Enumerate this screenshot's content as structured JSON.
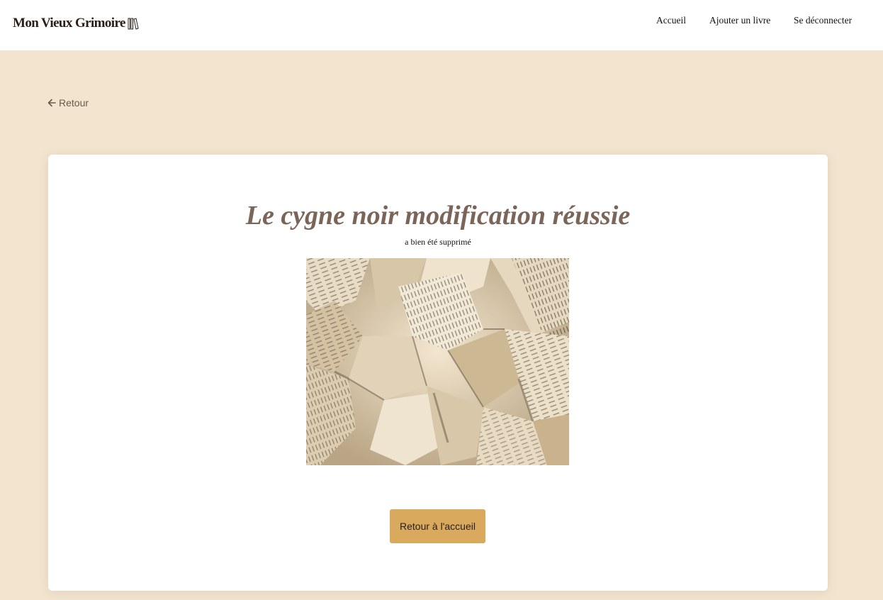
{
  "header": {
    "logo_text": "Mon Vieux Grimoire",
    "logo_icon": "books-icon",
    "nav": [
      {
        "label": "Accueil"
      },
      {
        "label": "Ajouter un livre"
      },
      {
        "label": "Se déconnecter"
      }
    ]
  },
  "back_link": {
    "label": "Retour",
    "icon": "arrow-left-icon"
  },
  "card": {
    "title": "Le cygne noir modification réussie",
    "subtitle": "a bien été supprimé",
    "image": "crumpled-book-pages",
    "button_label": "Retour à l'accueil"
  },
  "colors": {
    "page_background": "#f2e4cf",
    "card_background": "#ffffff",
    "title": "#7a6558",
    "button": "#d9aa5e"
  }
}
